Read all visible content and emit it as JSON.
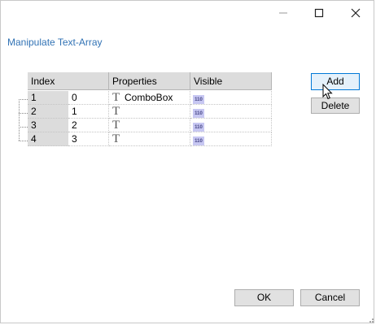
{
  "titlebar": {
    "minimize_icon": "minimize-icon",
    "maximize_icon": "maximize-icon",
    "close_icon": "close-icon"
  },
  "dialog": {
    "title": "Manipulate Text-Array"
  },
  "grid": {
    "columns": [
      "Index",
      "",
      "Properties",
      "Visible"
    ],
    "rows": [
      {
        "index": "1",
        "value": "0",
        "property": "ComboBox",
        "visible": "110"
      },
      {
        "index": "2",
        "value": "1",
        "property": "",
        "visible": "110"
      },
      {
        "index": "3",
        "value": "2",
        "property": "",
        "visible": "110"
      },
      {
        "index": "4",
        "value": "3",
        "property": "",
        "visible": "110"
      }
    ],
    "property_icon": "text-type-icon",
    "visible_icon": "binary-visible-icon"
  },
  "buttons": {
    "add": "Add",
    "delete": "Delete",
    "ok": "OK",
    "cancel": "Cancel"
  },
  "colors": {
    "title_link": "#3273b5",
    "header_bg": "#dcdcdc",
    "focused_border": "#0078d7"
  }
}
